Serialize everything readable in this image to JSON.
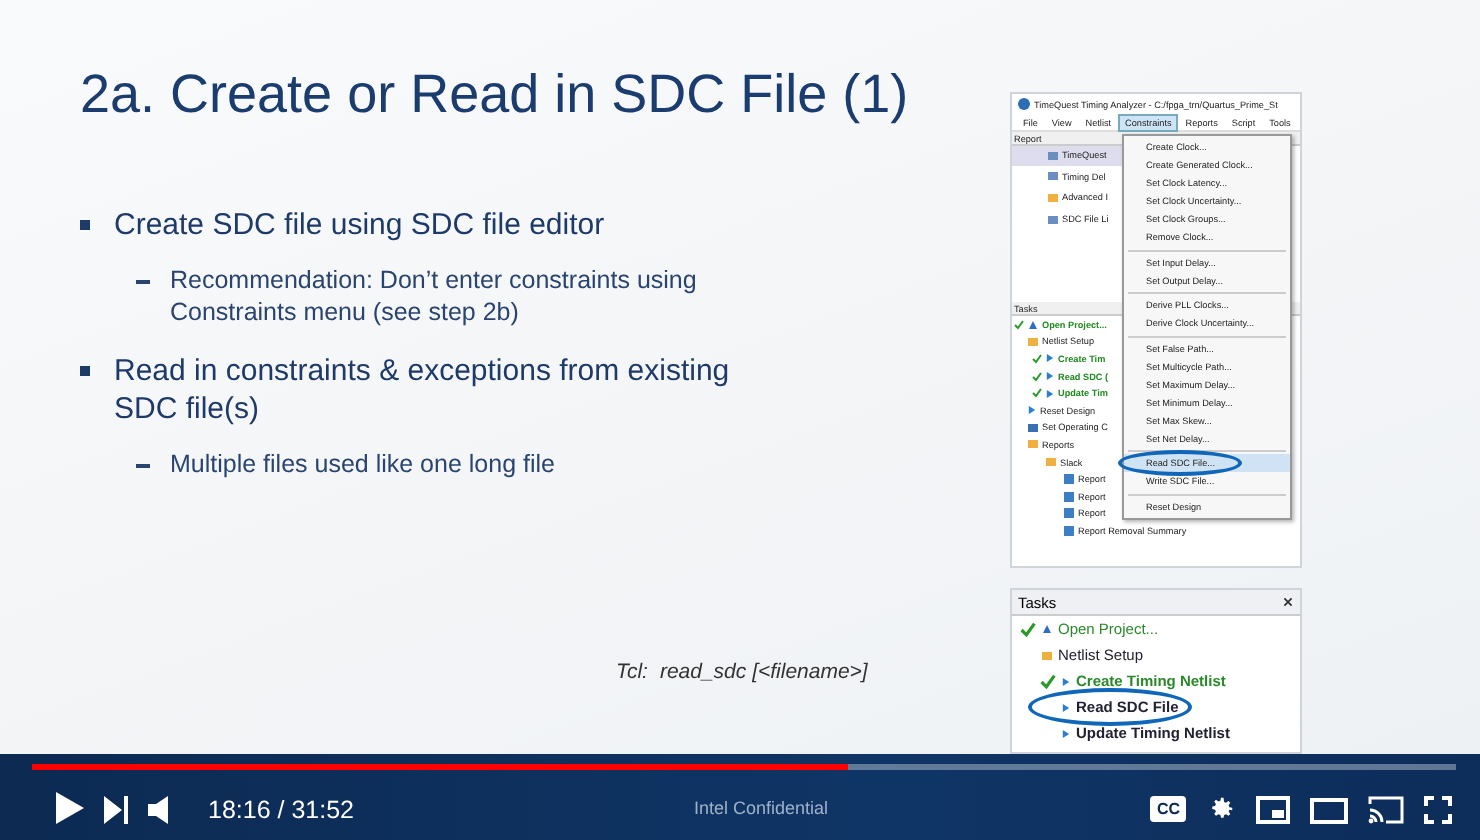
{
  "slide": {
    "title": "2a. Create or Read in SDC File (1)",
    "bullets": [
      {
        "text": "Create SDC file using SDC file editor",
        "children": [
          "Recommendation: Don’t enter constraints using Constraints menu (see step 2b)"
        ]
      },
      {
        "text": "Read in constraints & exceptions from existing SDC file(s)",
        "children": [
          "Multiple files used like one long file"
        ]
      }
    ],
    "tcl": {
      "label": "Tcl:",
      "command": "read_sdc [<filename>]"
    },
    "footer": "Intel Confidential"
  },
  "app_window": {
    "title": "TimeQuest Timing Analyzer - C:/fpga_trn/Quartus_Prime_St",
    "menu": [
      {
        "label": "File",
        "selected": false
      },
      {
        "label": "View",
        "selected": false
      },
      {
        "label": "Netlist",
        "selected": false
      },
      {
        "label": "Constraints",
        "selected": true
      },
      {
        "label": "Reports",
        "selected": false
      },
      {
        "label": "Script",
        "selected": false
      },
      {
        "label": "Tools",
        "selected": false
      }
    ],
    "report_header": "Report",
    "report_items": [
      {
        "label": "TimeQuest",
        "kind": "table",
        "selected": true
      },
      {
        "label": "Timing Del",
        "kind": "table",
        "selected": false
      },
      {
        "label": "Advanced I",
        "kind": "folder",
        "selected": false
      },
      {
        "label": "SDC File Li",
        "kind": "table",
        "selected": false
      }
    ],
    "tasks_header": "Tasks",
    "tasks": [
      {
        "label": "Open Project...",
        "kind": "project",
        "checked": true,
        "done": true
      },
      {
        "label": "Netlist Setup",
        "kind": "folder",
        "checked": false,
        "done": false,
        "children": [
          {
            "label": "Create Tim",
            "kind": "run",
            "checked": true,
            "done": true
          },
          {
            "label": "Read SDC (",
            "kind": "run",
            "checked": true,
            "done": true
          },
          {
            "label": "Update Tim",
            "kind": "run",
            "checked": true,
            "done": true
          }
        ]
      },
      {
        "label": "Reset Design",
        "kind": "run",
        "checked": false,
        "done": false
      },
      {
        "label": "Set Operating C",
        "kind": "setting",
        "checked": false,
        "done": false
      },
      {
        "label": "Reports",
        "kind": "folder",
        "checked": false,
        "done": false,
        "children": [
          {
            "label": "Slack",
            "kind": "folder",
            "checked": false,
            "done": false,
            "children": [
              {
                "label": "Report",
                "kind": "report",
                "checked": false,
                "done": false
              },
              {
                "label": "Report",
                "kind": "report",
                "checked": false,
                "done": false
              },
              {
                "label": "Report",
                "kind": "report",
                "checked": false,
                "done": false
              },
              {
                "label": "Report Removal Summary",
                "kind": "report",
                "checked": false,
                "done": false
              }
            ]
          }
        ]
      }
    ],
    "dropdown": [
      [
        {
          "label": "Create Clock...",
          "selected": false
        },
        {
          "label": "Create Generated Clock...",
          "selected": false
        },
        {
          "label": "Set Clock Latency...",
          "selected": false
        },
        {
          "label": "Set Clock Uncertainty...",
          "selected": false
        },
        {
          "label": "Set Clock Groups...",
          "selected": false
        },
        {
          "label": "Remove Clock...",
          "selected": false
        }
      ],
      [
        {
          "label": "Set Input Delay...",
          "selected": false
        },
        {
          "label": "Set Output Delay...",
          "selected": false
        }
      ],
      [
        {
          "label": "Derive PLL Clocks...",
          "selected": false
        },
        {
          "label": "Derive Clock Uncertainty...",
          "selected": false
        }
      ],
      [
        {
          "label": "Set False Path...",
          "selected": false
        },
        {
          "label": "Set Multicycle Path...",
          "selected": false
        },
        {
          "label": "Set Maximum Delay...",
          "selected": false
        },
        {
          "label": "Set Minimum Delay...",
          "selected": false
        },
        {
          "label": "Set Max Skew...",
          "selected": false
        },
        {
          "label": "Set Net Delay...",
          "selected": false
        }
      ],
      [
        {
          "label": "Read SDC File...",
          "selected": true
        },
        {
          "label": "Write SDC File...",
          "selected": false
        }
      ],
      [
        {
          "label": "Reset Design",
          "selected": false
        }
      ]
    ]
  },
  "tasks_panel": {
    "header": "Tasks",
    "items": [
      {
        "label": "Open Project...",
        "kind": "project",
        "checked": true,
        "done": true,
        "selected": false
      },
      {
        "label": "Netlist Setup",
        "kind": "folder",
        "checked": false,
        "done": false,
        "selected": false
      },
      {
        "label": "Create Timing Netlist",
        "kind": "run",
        "checked": true,
        "done": true,
        "selected": false
      },
      {
        "label": "Read SDC File",
        "kind": "run",
        "checked": false,
        "done": false,
        "selected": true
      },
      {
        "label": "Update Timing Netlist",
        "kind": "run",
        "checked": false,
        "done": false,
        "selected": false
      }
    ]
  },
  "player": {
    "time": "18:16 / 31:52",
    "captions_label": "CC",
    "progress": {
      "level": 0.573
    }
  }
}
